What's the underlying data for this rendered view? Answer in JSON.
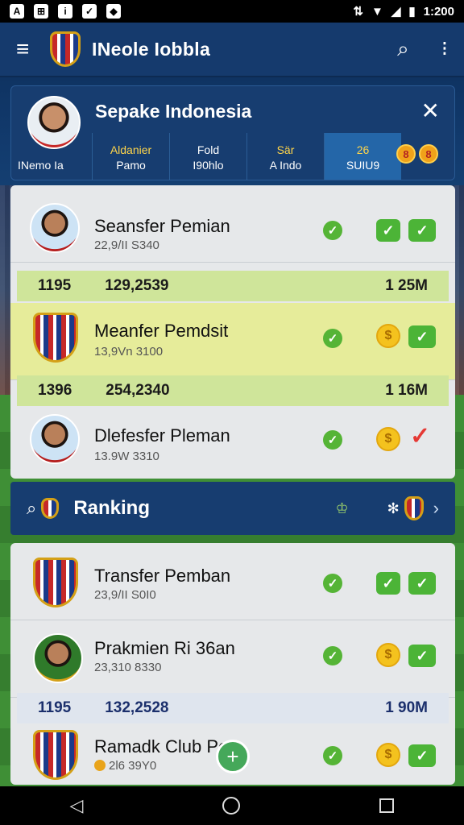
{
  "status_bar": {
    "icons": [
      "A",
      "⊞",
      "i",
      "✓",
      "◆"
    ],
    "time": "1:200"
  },
  "app": {
    "title": "INeole Iobbla"
  },
  "profile": {
    "name": "Sepake Indonesia",
    "subtitle": "INemo Ia",
    "stats": [
      {
        "top": "Aldanier",
        "bottom": "Pamo"
      },
      {
        "top": "Fold",
        "bottom": "I90hlo"
      },
      {
        "top": "Sär",
        "bottom": "A Indo"
      },
      {
        "top": "26",
        "bottom": "SUIU9"
      }
    ],
    "coins": [
      "8",
      "8"
    ]
  },
  "list_top": {
    "rows": [
      {
        "name": "Seansfer Pemian",
        "sub": "22,9/II S340"
      },
      {
        "name": "Meanfer Pemdsit",
        "sub": "13,9Vn 3100"
      },
      {
        "name": "Dlefesfer Pleman",
        "sub": "13.9W 3310"
      }
    ],
    "bands": [
      {
        "rank": "1195",
        "value": "129,2539",
        "money": "1 25M"
      },
      {
        "rank": "1396",
        "value": "254,2340",
        "money": "1 16M"
      }
    ]
  },
  "ranking": {
    "label": "Ranking"
  },
  "list_bottom": {
    "rows": [
      {
        "name": "Transfer Pemban",
        "sub": "23,9/II S0I0"
      },
      {
        "name": "Prakmien Ri 36an",
        "sub": "23,310 8330"
      },
      {
        "name": "Ramadk Club Pe",
        "sub": "2l6 39Y0"
      }
    ],
    "band": {
      "rank": "1195",
      "value": "132,2528",
      "money": "1 90M"
    }
  },
  "colors": {
    "header": "#153a6d",
    "accent_green": "#4cb437",
    "coin": "#f4c21e",
    "highlight": "#e6ec9a"
  }
}
